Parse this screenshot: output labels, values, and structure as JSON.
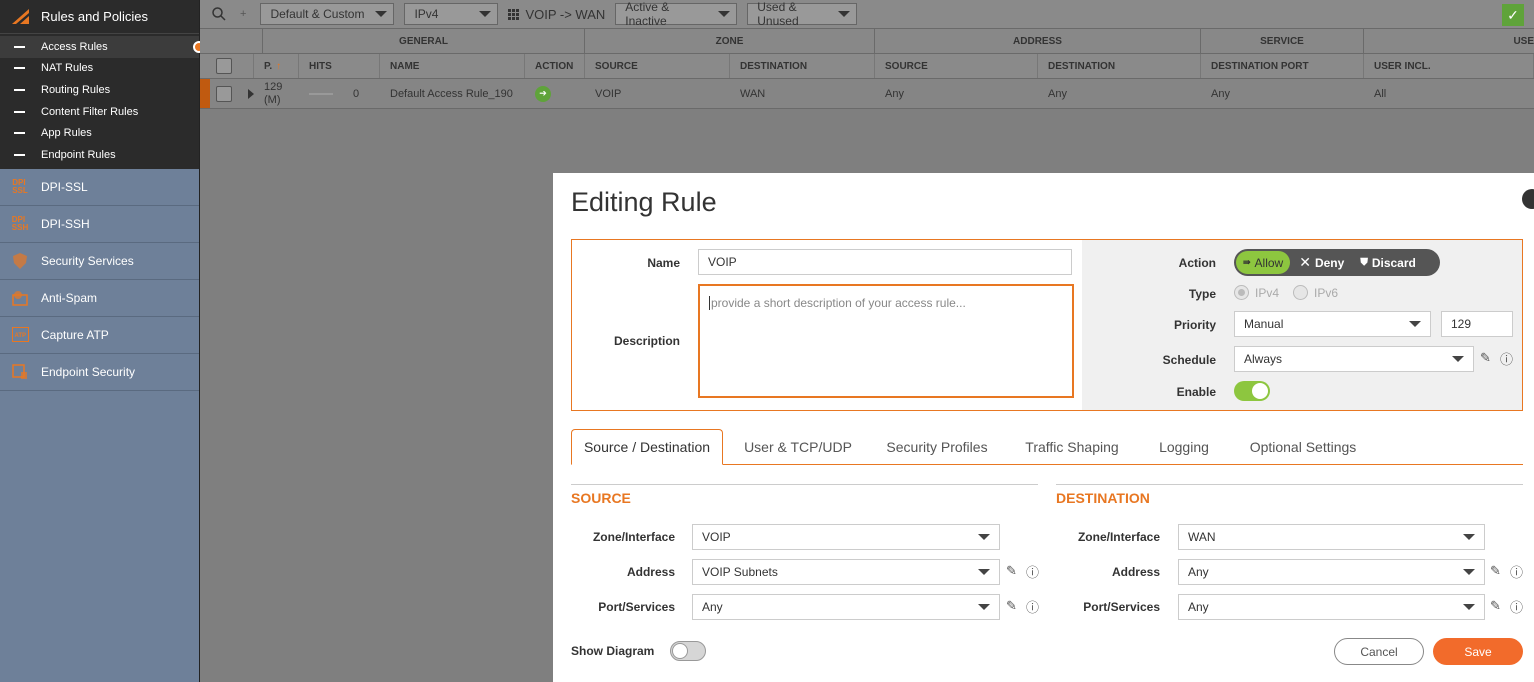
{
  "sidebar": {
    "header": "Rules and Policies",
    "sub_items": [
      {
        "label": "Access Rules"
      },
      {
        "label": "NAT Rules"
      },
      {
        "label": "Routing Rules"
      },
      {
        "label": "Content Filter Rules"
      },
      {
        "label": "App Rules"
      },
      {
        "label": "Endpoint Rules"
      }
    ],
    "items": [
      {
        "label": "DPI-SSL",
        "icon": "dpi-ssl-icon"
      },
      {
        "label": "DPI-SSH",
        "icon": "dpi-ssh-icon"
      },
      {
        "label": "Security Services",
        "icon": "shield-icon"
      },
      {
        "label": "Anti-Spam",
        "icon": "anti-spam-icon"
      },
      {
        "label": "Capture ATP",
        "icon": "atp-icon"
      },
      {
        "label": "Endpoint Security",
        "icon": "endpoint-icon"
      }
    ]
  },
  "toolbar": {
    "view_filter": "Default & Custom",
    "ip_version": "IPv4",
    "zone_pair": "VOIP -> WAN",
    "state_filter": "Active & Inactive",
    "usage_filter": "Used & Unused"
  },
  "table": {
    "groups": [
      "GENERAL",
      "ZONE",
      "ADDRESS",
      "SERVICE",
      "USE"
    ],
    "columns": [
      "P.",
      "HITS",
      "NAME",
      "ACTION",
      "SOURCE",
      "DESTINATION",
      "SOURCE",
      "DESTINATION",
      "DESTINATION PORT",
      "USER INCL."
    ],
    "row": {
      "priority": "129",
      "priority_suffix": "(M)",
      "hits": "0",
      "name": "Default Access Rule_190",
      "src_zone": "VOIP",
      "dst_zone": "WAN",
      "src_addr": "Any",
      "dst_addr": "Any",
      "dst_port": "Any",
      "user_incl": "All"
    }
  },
  "dialog": {
    "title": "Editing Rule",
    "name_label": "Name",
    "name_value": "VOIP",
    "description_label": "Description",
    "description_placeholder": "provide a short description of your access rule...",
    "action_label": "Action",
    "actions": {
      "allow": "Allow",
      "deny": "Deny",
      "discard": "Discard"
    },
    "type_label": "Type",
    "type_ipv4": "IPv4",
    "type_ipv6": "IPv6",
    "priority_label": "Priority",
    "priority_mode": "Manual",
    "priority_value": "129",
    "schedule_label": "Schedule",
    "schedule_value": "Always",
    "enable_label": "Enable",
    "enable_on": true,
    "tabs": [
      "Source / Destination",
      "User & TCP/UDP",
      "Security Profiles",
      "Traffic Shaping",
      "Logging",
      "Optional Settings"
    ],
    "source": {
      "title": "SOURCE",
      "zone_label": "Zone/Interface",
      "zone_value": "VOIP",
      "address_label": "Address",
      "address_value": "VOIP Subnets",
      "port_label": "Port/Services",
      "port_value": "Any"
    },
    "destination": {
      "title": "DESTINATION",
      "zone_label": "Zone/Interface",
      "zone_value": "WAN",
      "address_label": "Address",
      "address_value": "Any",
      "port_label": "Port/Services",
      "port_value": "Any"
    },
    "show_diagram_label": "Show Diagram",
    "show_diagram_on": false,
    "cancel_label": "Cancel",
    "save_label": "Save"
  },
  "colors": {
    "accent": "#e87722",
    "allow_green": "#8dc63f",
    "sidebar_bg": "#6e8099"
  }
}
